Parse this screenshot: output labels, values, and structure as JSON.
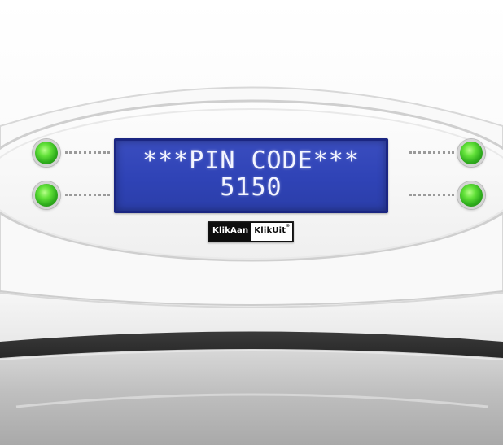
{
  "display": {
    "line1": "***PIN CODE***",
    "line2": "5150"
  },
  "brand": {
    "left": "KlikAan",
    "right": "KlikUit",
    "mark": "®"
  },
  "leds": [
    "green-led",
    "green-led",
    "green-led",
    "green-led"
  ],
  "colors": {
    "lcd_background": "#3042b4",
    "lcd_text": "#f3f5ff",
    "led_green": "#49d22a",
    "panel": "#f7f7f7"
  }
}
